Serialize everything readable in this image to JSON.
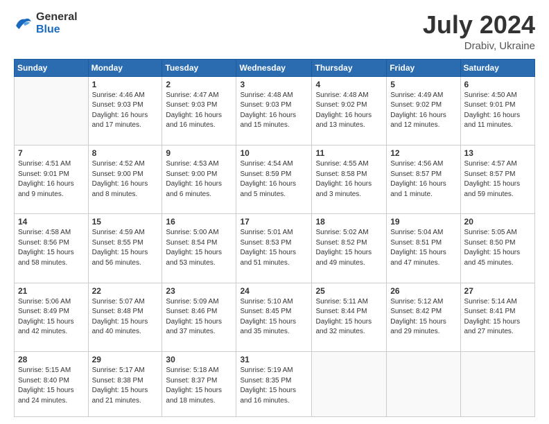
{
  "header": {
    "logo_general": "General",
    "logo_blue": "Blue",
    "month_year": "July 2024",
    "location": "Drabiv, Ukraine"
  },
  "days_of_week": [
    "Sunday",
    "Monday",
    "Tuesday",
    "Wednesday",
    "Thursday",
    "Friday",
    "Saturday"
  ],
  "weeks": [
    [
      {
        "day": "",
        "info": ""
      },
      {
        "day": "1",
        "info": "Sunrise: 4:46 AM\nSunset: 9:03 PM\nDaylight: 16 hours\nand 17 minutes."
      },
      {
        "day": "2",
        "info": "Sunrise: 4:47 AM\nSunset: 9:03 PM\nDaylight: 16 hours\nand 16 minutes."
      },
      {
        "day": "3",
        "info": "Sunrise: 4:48 AM\nSunset: 9:03 PM\nDaylight: 16 hours\nand 15 minutes."
      },
      {
        "day": "4",
        "info": "Sunrise: 4:48 AM\nSunset: 9:02 PM\nDaylight: 16 hours\nand 13 minutes."
      },
      {
        "day": "5",
        "info": "Sunrise: 4:49 AM\nSunset: 9:02 PM\nDaylight: 16 hours\nand 12 minutes."
      },
      {
        "day": "6",
        "info": "Sunrise: 4:50 AM\nSunset: 9:01 PM\nDaylight: 16 hours\nand 11 minutes."
      }
    ],
    [
      {
        "day": "7",
        "info": "Sunrise: 4:51 AM\nSunset: 9:01 PM\nDaylight: 16 hours\nand 9 minutes."
      },
      {
        "day": "8",
        "info": "Sunrise: 4:52 AM\nSunset: 9:00 PM\nDaylight: 16 hours\nand 8 minutes."
      },
      {
        "day": "9",
        "info": "Sunrise: 4:53 AM\nSunset: 9:00 PM\nDaylight: 16 hours\nand 6 minutes."
      },
      {
        "day": "10",
        "info": "Sunrise: 4:54 AM\nSunset: 8:59 PM\nDaylight: 16 hours\nand 5 minutes."
      },
      {
        "day": "11",
        "info": "Sunrise: 4:55 AM\nSunset: 8:58 PM\nDaylight: 16 hours\nand 3 minutes."
      },
      {
        "day": "12",
        "info": "Sunrise: 4:56 AM\nSunset: 8:57 PM\nDaylight: 16 hours\nand 1 minute."
      },
      {
        "day": "13",
        "info": "Sunrise: 4:57 AM\nSunset: 8:57 PM\nDaylight: 15 hours\nand 59 minutes."
      }
    ],
    [
      {
        "day": "14",
        "info": "Sunrise: 4:58 AM\nSunset: 8:56 PM\nDaylight: 15 hours\nand 58 minutes."
      },
      {
        "day": "15",
        "info": "Sunrise: 4:59 AM\nSunset: 8:55 PM\nDaylight: 15 hours\nand 56 minutes."
      },
      {
        "day": "16",
        "info": "Sunrise: 5:00 AM\nSunset: 8:54 PM\nDaylight: 15 hours\nand 53 minutes."
      },
      {
        "day": "17",
        "info": "Sunrise: 5:01 AM\nSunset: 8:53 PM\nDaylight: 15 hours\nand 51 minutes."
      },
      {
        "day": "18",
        "info": "Sunrise: 5:02 AM\nSunset: 8:52 PM\nDaylight: 15 hours\nand 49 minutes."
      },
      {
        "day": "19",
        "info": "Sunrise: 5:04 AM\nSunset: 8:51 PM\nDaylight: 15 hours\nand 47 minutes."
      },
      {
        "day": "20",
        "info": "Sunrise: 5:05 AM\nSunset: 8:50 PM\nDaylight: 15 hours\nand 45 minutes."
      }
    ],
    [
      {
        "day": "21",
        "info": "Sunrise: 5:06 AM\nSunset: 8:49 PM\nDaylight: 15 hours\nand 42 minutes."
      },
      {
        "day": "22",
        "info": "Sunrise: 5:07 AM\nSunset: 8:48 PM\nDaylight: 15 hours\nand 40 minutes."
      },
      {
        "day": "23",
        "info": "Sunrise: 5:09 AM\nSunset: 8:46 PM\nDaylight: 15 hours\nand 37 minutes."
      },
      {
        "day": "24",
        "info": "Sunrise: 5:10 AM\nSunset: 8:45 PM\nDaylight: 15 hours\nand 35 minutes."
      },
      {
        "day": "25",
        "info": "Sunrise: 5:11 AM\nSunset: 8:44 PM\nDaylight: 15 hours\nand 32 minutes."
      },
      {
        "day": "26",
        "info": "Sunrise: 5:12 AM\nSunset: 8:42 PM\nDaylight: 15 hours\nand 29 minutes."
      },
      {
        "day": "27",
        "info": "Sunrise: 5:14 AM\nSunset: 8:41 PM\nDaylight: 15 hours\nand 27 minutes."
      }
    ],
    [
      {
        "day": "28",
        "info": "Sunrise: 5:15 AM\nSunset: 8:40 PM\nDaylight: 15 hours\nand 24 minutes."
      },
      {
        "day": "29",
        "info": "Sunrise: 5:17 AM\nSunset: 8:38 PM\nDaylight: 15 hours\nand 21 minutes."
      },
      {
        "day": "30",
        "info": "Sunrise: 5:18 AM\nSunset: 8:37 PM\nDaylight: 15 hours\nand 18 minutes."
      },
      {
        "day": "31",
        "info": "Sunrise: 5:19 AM\nSunset: 8:35 PM\nDaylight: 15 hours\nand 16 minutes."
      },
      {
        "day": "",
        "info": ""
      },
      {
        "day": "",
        "info": ""
      },
      {
        "day": "",
        "info": ""
      }
    ]
  ]
}
